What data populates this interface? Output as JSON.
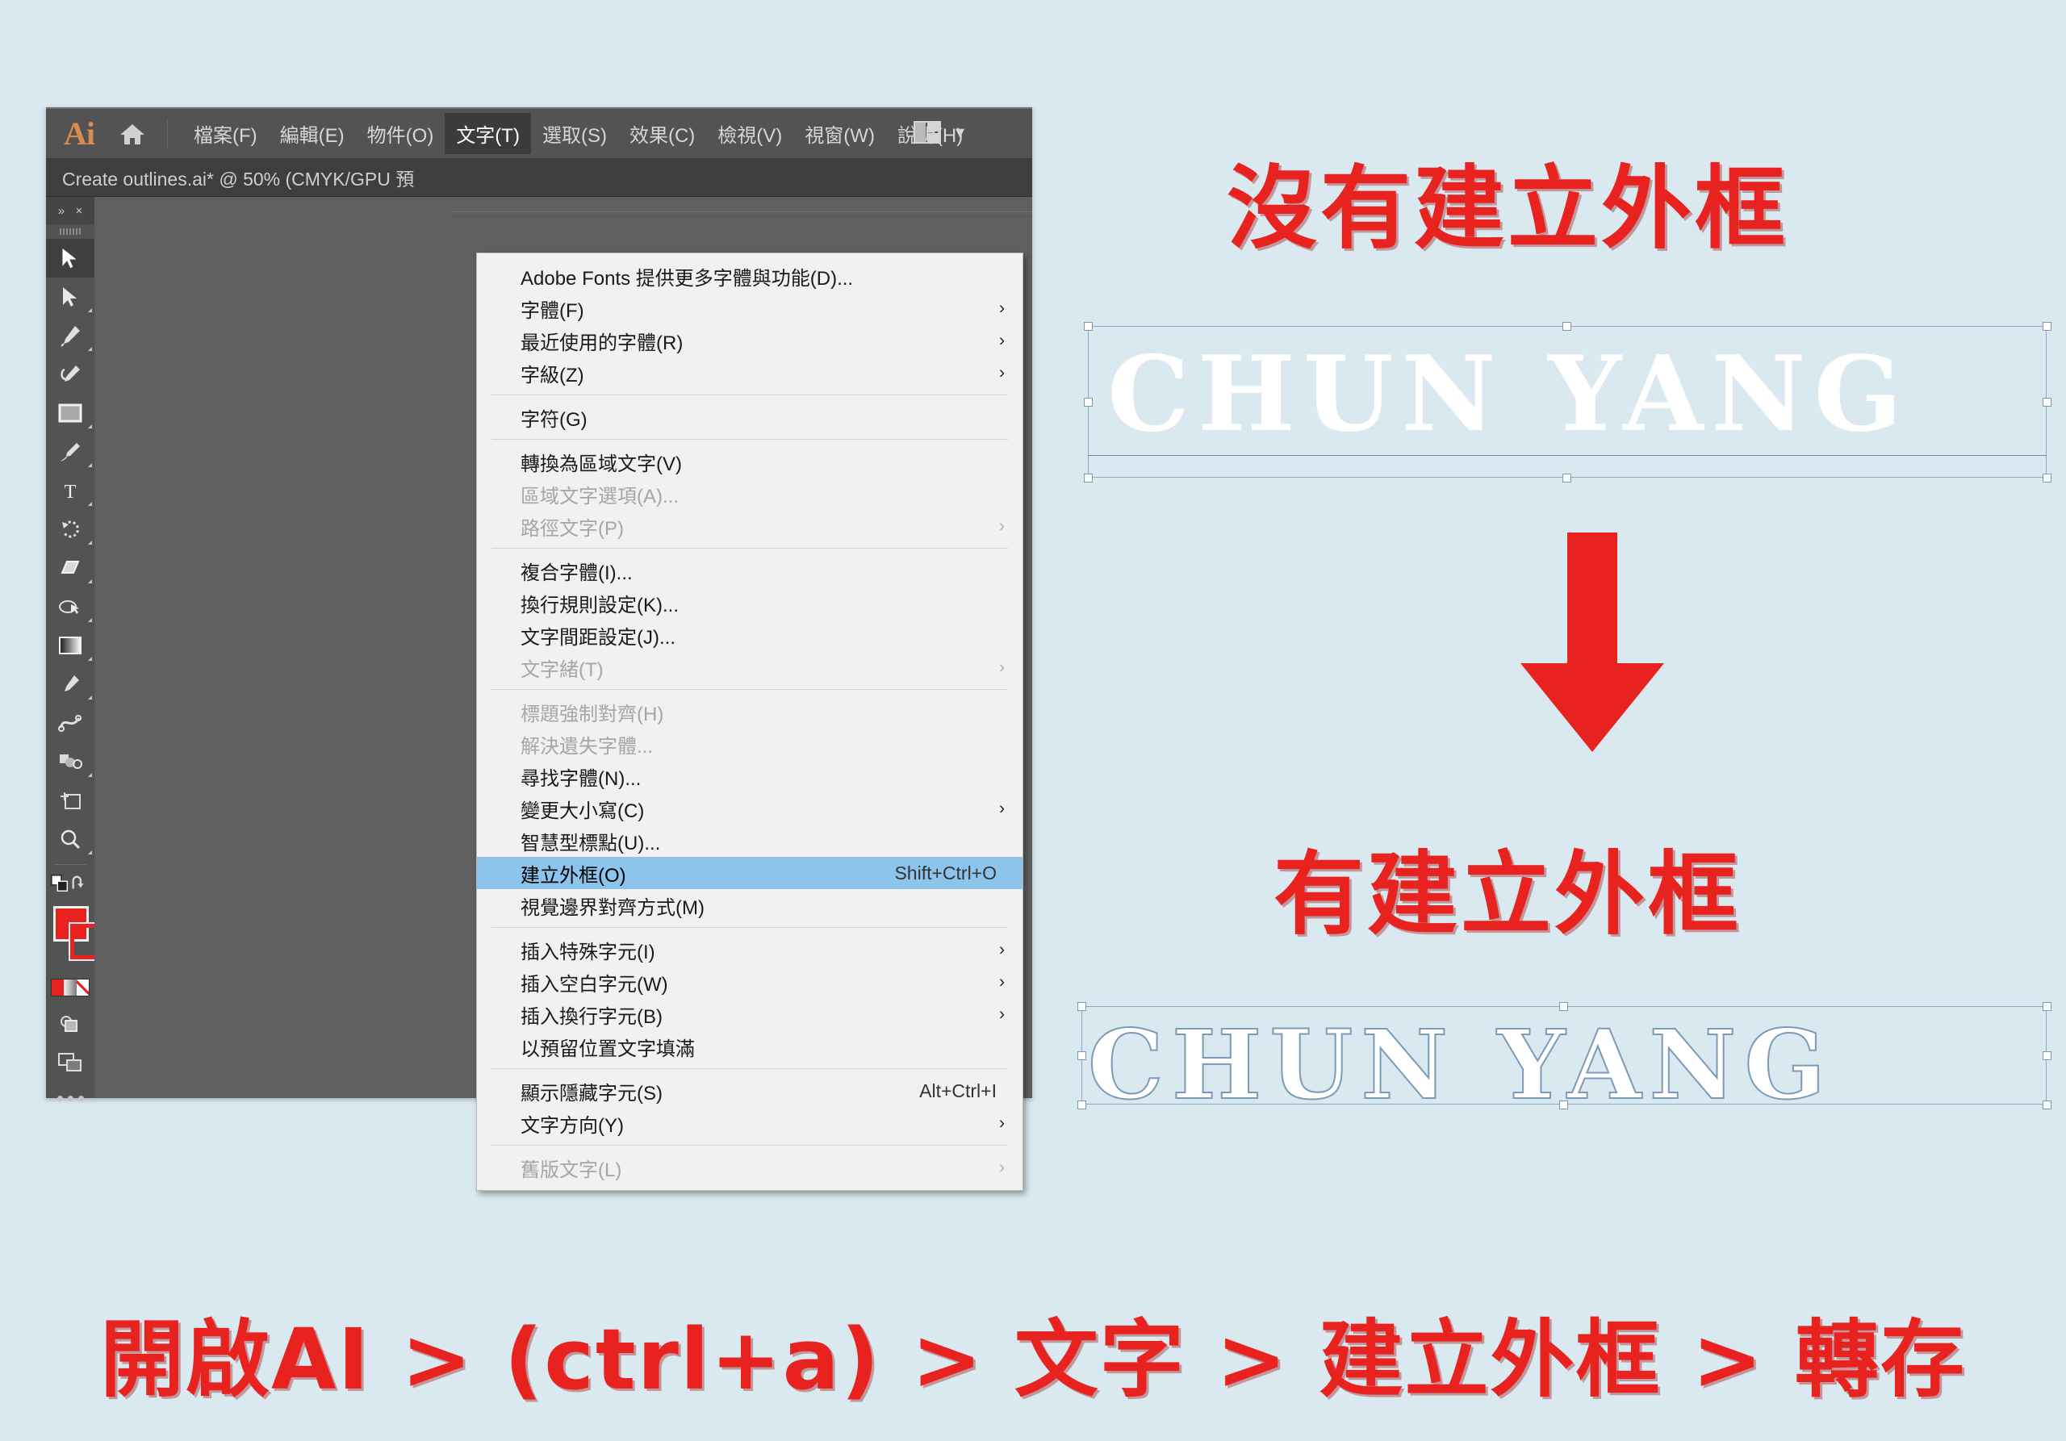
{
  "app": {
    "logo": "Ai",
    "home_icon": "home-icon",
    "workspace_icon": "workspace-switcher-icon",
    "workspace_chevron": "chevron-down-icon",
    "document_tab": "Create outlines.ai* @ 50% (CMYK/GPU 預",
    "panel_collapse": "»",
    "panel_close": "×"
  },
  "menubar": [
    {
      "label": "檔案(F)",
      "active": false
    },
    {
      "label": "編輯(E)",
      "active": false
    },
    {
      "label": "物件(O)",
      "active": false
    },
    {
      "label": "文字(T)",
      "active": true
    },
    {
      "label": "選取(S)",
      "active": false
    },
    {
      "label": "效果(C)",
      "active": false
    },
    {
      "label": "檢視(V)",
      "active": false
    },
    {
      "label": "視窗(W)",
      "active": false
    },
    {
      "label": "說明(H)",
      "active": false
    }
  ],
  "dropdown": {
    "items": [
      {
        "type": "item",
        "label": "Adobe Fonts 提供更多字體與功能(D)...",
        "accel": "",
        "arrow": false,
        "disabled": false,
        "highlight": false
      },
      {
        "type": "item",
        "label": "字體(F)",
        "accel": "",
        "arrow": true,
        "disabled": false,
        "highlight": false
      },
      {
        "type": "item",
        "label": "最近使用的字體(R)",
        "accel": "",
        "arrow": true,
        "disabled": false,
        "highlight": false
      },
      {
        "type": "item",
        "label": "字級(Z)",
        "accel": "",
        "arrow": true,
        "disabled": false,
        "highlight": false
      },
      {
        "type": "sep"
      },
      {
        "type": "item",
        "label": "字符(G)",
        "accel": "",
        "arrow": false,
        "disabled": false,
        "highlight": false
      },
      {
        "type": "sep"
      },
      {
        "type": "item",
        "label": "轉換為區域文字(V)",
        "accel": "",
        "arrow": false,
        "disabled": false,
        "highlight": false
      },
      {
        "type": "item",
        "label": "區域文字選項(A)...",
        "accel": "",
        "arrow": false,
        "disabled": true,
        "highlight": false
      },
      {
        "type": "item",
        "label": "路徑文字(P)",
        "accel": "",
        "arrow": true,
        "disabled": true,
        "highlight": false
      },
      {
        "type": "sep"
      },
      {
        "type": "item",
        "label": "複合字體(I)...",
        "accel": "",
        "arrow": false,
        "disabled": false,
        "highlight": false
      },
      {
        "type": "item",
        "label": "換行規則設定(K)...",
        "accel": "",
        "arrow": false,
        "disabled": false,
        "highlight": false
      },
      {
        "type": "item",
        "label": "文字間距設定(J)...",
        "accel": "",
        "arrow": false,
        "disabled": false,
        "highlight": false
      },
      {
        "type": "item",
        "label": "文字緒(T)",
        "accel": "",
        "arrow": true,
        "disabled": true,
        "highlight": false
      },
      {
        "type": "sep"
      },
      {
        "type": "item",
        "label": "標題強制對齊(H)",
        "accel": "",
        "arrow": false,
        "disabled": true,
        "highlight": false
      },
      {
        "type": "item",
        "label": "解決遺失字體...",
        "accel": "",
        "arrow": false,
        "disabled": true,
        "highlight": false
      },
      {
        "type": "item",
        "label": "尋找字體(N)...",
        "accel": "",
        "arrow": false,
        "disabled": false,
        "highlight": false
      },
      {
        "type": "item",
        "label": "變更大小寫(C)",
        "accel": "",
        "arrow": true,
        "disabled": false,
        "highlight": false
      },
      {
        "type": "item",
        "label": "智慧型標點(U)...",
        "accel": "",
        "arrow": false,
        "disabled": false,
        "highlight": false
      },
      {
        "type": "item",
        "label": "建立外框(O)",
        "accel": "Shift+Ctrl+O",
        "arrow": false,
        "disabled": false,
        "highlight": true
      },
      {
        "type": "item",
        "label": "視覺邊界對齊方式(M)",
        "accel": "",
        "arrow": false,
        "disabled": false,
        "highlight": false
      },
      {
        "type": "sep"
      },
      {
        "type": "item",
        "label": "插入特殊字元(I)",
        "accel": "",
        "arrow": true,
        "disabled": false,
        "highlight": false
      },
      {
        "type": "item",
        "label": "插入空白字元(W)",
        "accel": "",
        "arrow": true,
        "disabled": false,
        "highlight": false
      },
      {
        "type": "item",
        "label": "插入換行字元(B)",
        "accel": "",
        "arrow": true,
        "disabled": false,
        "highlight": false
      },
      {
        "type": "item",
        "label": "以預留位置文字填滿",
        "accel": "",
        "arrow": false,
        "disabled": false,
        "highlight": false
      },
      {
        "type": "sep"
      },
      {
        "type": "item",
        "label": "顯示隱藏字元(S)",
        "accel": "Alt+Ctrl+I",
        "arrow": false,
        "disabled": false,
        "highlight": false
      },
      {
        "type": "item",
        "label": "文字方向(Y)",
        "accel": "",
        "arrow": true,
        "disabled": false,
        "highlight": false
      },
      {
        "type": "sep"
      },
      {
        "type": "item",
        "label": "舊版文字(L)",
        "accel": "",
        "arrow": true,
        "disabled": true,
        "highlight": false
      }
    ]
  },
  "toolbar": {
    "tools": [
      {
        "name": "selection-tool",
        "selected": true,
        "corner": false
      },
      {
        "name": "direct-selection-tool",
        "selected": false,
        "corner": true
      },
      {
        "name": "pen-tool",
        "selected": false,
        "corner": true
      },
      {
        "name": "curvature-tool",
        "selected": false,
        "corner": false
      },
      {
        "name": "rectangle-tool",
        "selected": false,
        "corner": true
      },
      {
        "name": "paintbrush-tool",
        "selected": false,
        "corner": true
      },
      {
        "name": "type-tool",
        "selected": false,
        "corner": true
      },
      {
        "name": "rotate-tool",
        "selected": false,
        "corner": true
      },
      {
        "name": "eraser-tool",
        "selected": false,
        "corner": true
      },
      {
        "name": "shape-builder-tool",
        "selected": false,
        "corner": true
      },
      {
        "name": "gradient-tool",
        "selected": false,
        "corner": true
      },
      {
        "name": "eyedropper-tool",
        "selected": false,
        "corner": true
      },
      {
        "name": "blend-tool",
        "selected": false,
        "corner": false
      },
      {
        "name": "symbol-sprayer-tool",
        "selected": false,
        "corner": true
      },
      {
        "name": "artboard-tool",
        "selected": false,
        "corner": false
      },
      {
        "name": "zoom-tool",
        "selected": false,
        "corner": true
      }
    ],
    "fill_color": "#e8231f",
    "stroke_color": "#e8231f",
    "mini_swatches": [
      "#e8231f",
      "gradient",
      "none"
    ],
    "more_tools": "…"
  },
  "annotations": {
    "heading_no_outline": "沒有建立外框",
    "heading_has_outline": "有建立外框",
    "arrow": "down-arrow-icon",
    "arrow_color": "#e8231f",
    "bottom_caption": "開啟AI > (ctrl+a) > 文字 > 建立外框 > 轉存",
    "red": "#e8231f",
    "background": "#dae8ef"
  },
  "artwork": {
    "wordmark_plain": "CHUN YANG",
    "wordmark_outlined": "CHUN YANG",
    "wordmark_color": "#ffffff",
    "selection_color": "#7e98b4"
  }
}
